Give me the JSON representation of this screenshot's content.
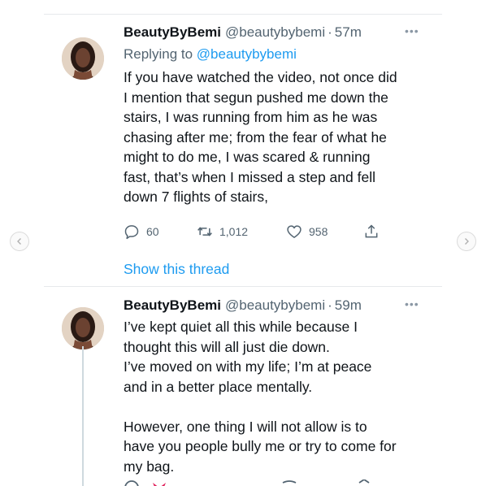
{
  "tweets": [
    {
      "name": "BeautyByBemi",
      "handle": "@beautybybemi",
      "separator": "·",
      "time": "57m",
      "more": "•••",
      "reply_prefix": "Replying to",
      "reply_to": "@beautybybemi",
      "text": "If you have watched the video, not once did\nI mention that segun pushed me down the\nstairs, I was running from him as he was\nchasing after me; from the fear of what he\nmight to do me, I was scared & running\nfast, that’s when I missed a step and fell\ndown 7 flights of stairs,",
      "replies": "60",
      "retweets": "1,012",
      "likes": "958",
      "show_thread": "Show this thread"
    },
    {
      "name": "BeautyByBemi",
      "handle": "@beautybybemi",
      "separator": "·",
      "time": "59m",
      "more": "•••",
      "text": "I’ve kept quiet all this while because I\nthought this will all just die down.\nI’ve moved on with my life; I’m at peace\nand in a better place mentally.\n\nHowever, one thing I will not allow is to\nhave you people bully me or try to come for\nmy bag."
    }
  ],
  "icons": {
    "reply": "speech-bubble-icon",
    "retweet": "retweet-icon",
    "like": "heart-icon",
    "share": "share-icon",
    "prev": "chevron-left-icon",
    "next": "chevron-right-icon"
  },
  "colors": {
    "link": "#1d9bf0",
    "muted": "#536471",
    "text": "#0f1419",
    "divider": "#e6e9ec"
  }
}
